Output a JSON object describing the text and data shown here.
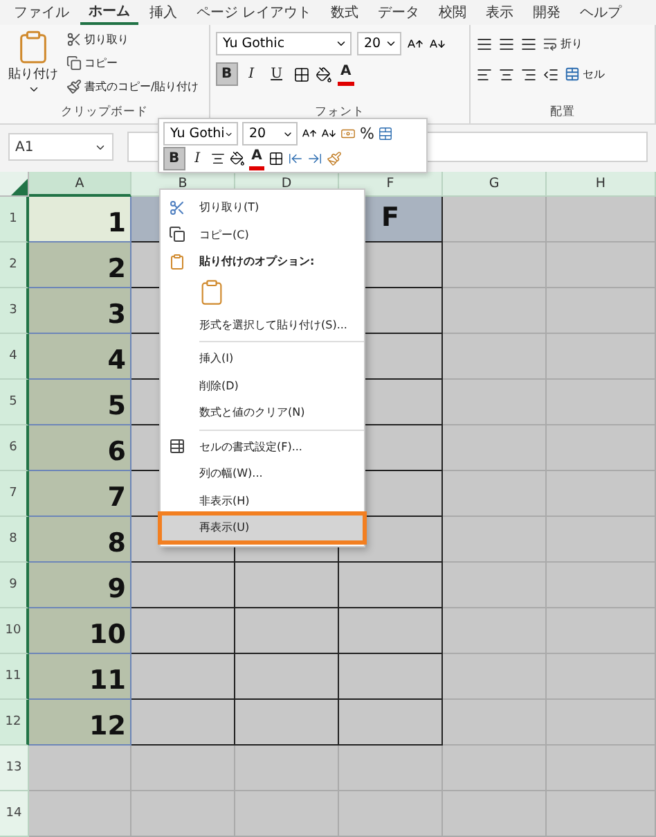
{
  "ribbon": {
    "tabs": [
      {
        "label": "ファイル",
        "selected": false
      },
      {
        "label": "ホーム",
        "selected": true
      },
      {
        "label": "挿入",
        "selected": false
      },
      {
        "label": "ページ レイアウト",
        "selected": false
      },
      {
        "label": "数式",
        "selected": false
      },
      {
        "label": "データ",
        "selected": false
      },
      {
        "label": "校閲",
        "selected": false
      },
      {
        "label": "表示",
        "selected": false
      },
      {
        "label": "開発",
        "selected": false
      },
      {
        "label": "ヘルプ",
        "selected": false
      }
    ]
  },
  "clipboard": {
    "paste": "貼り付け",
    "commands": [
      {
        "kind": "cut",
        "label": "切り取り"
      },
      {
        "kind": "copy",
        "label": "コピー"
      },
      {
        "kind": "format-painter",
        "label": "書式のコピー/貼り付け"
      }
    ],
    "group_label": "クリップボード"
  },
  "font": {
    "name": "Yu Gothic",
    "size": "20",
    "bold": {
      "label": "B",
      "selected": true
    },
    "italic": "I",
    "underline": "U",
    "color_letter": "A",
    "group_label": "フォント"
  },
  "alignment": {
    "wrap": "折り",
    "merge": "セル",
    "group_label": "配置"
  },
  "name_box": "A1",
  "mini_toolbar": {
    "font": "Yu Gothi",
    "size": "20",
    "percent": "%",
    "bold": {
      "label": "B",
      "selected": true
    },
    "italic": "I",
    "color_letter": "A"
  },
  "columns": [
    {
      "label": "A",
      "selected": true
    },
    {
      "label": "B",
      "selected": false
    },
    {
      "label": "D",
      "selected": false
    },
    {
      "label": "F",
      "selected": false
    },
    {
      "label": "G",
      "selected": false
    },
    {
      "label": "H",
      "selected": false
    }
  ],
  "rows": [
    {
      "label": "1",
      "selected": true,
      "active": true,
      "highlighted": true,
      "bordered": true,
      "cells": {
        "A": "1",
        "F": "F"
      }
    },
    {
      "label": "2",
      "selected": true,
      "active": false,
      "highlighted": false,
      "bordered": true,
      "cells": {
        "A": "2"
      }
    },
    {
      "label": "3",
      "selected": true,
      "active": false,
      "highlighted": false,
      "bordered": true,
      "cells": {
        "A": "3"
      }
    },
    {
      "label": "4",
      "selected": true,
      "active": false,
      "highlighted": false,
      "bordered": true,
      "cells": {
        "A": "4"
      }
    },
    {
      "label": "5",
      "selected": true,
      "active": false,
      "highlighted": false,
      "bordered": true,
      "cells": {
        "A": "5"
      }
    },
    {
      "label": "6",
      "selected": true,
      "active": false,
      "highlighted": false,
      "bordered": true,
      "cells": {
        "A": "6"
      }
    },
    {
      "label": "7",
      "selected": true,
      "active": false,
      "highlighted": false,
      "bordered": true,
      "cells": {
        "A": "7"
      }
    },
    {
      "label": "8",
      "selected": true,
      "active": false,
      "highlighted": false,
      "bordered": true,
      "cells": {
        "A": "8"
      }
    },
    {
      "label": "9",
      "selected": true,
      "active": false,
      "highlighted": false,
      "bordered": true,
      "cells": {
        "A": "9"
      }
    },
    {
      "label": "10",
      "selected": true,
      "active": false,
      "highlighted": false,
      "bordered": true,
      "cells": {
        "A": "10"
      }
    },
    {
      "label": "11",
      "selected": true,
      "active": false,
      "highlighted": false,
      "bordered": true,
      "cells": {
        "A": "11"
      }
    },
    {
      "label": "12",
      "selected": true,
      "active": false,
      "highlighted": false,
      "bordered": true,
      "cells": {
        "A": "12"
      }
    },
    {
      "label": "13",
      "selected": false,
      "highlighted": false,
      "bordered": false
    },
    {
      "label": "14",
      "selected": false,
      "highlighted": false,
      "bordered": false
    }
  ],
  "context_menu": [
    {
      "kind": "cut",
      "label": "切り取り(T)",
      "selected": false
    },
    {
      "kind": "copy",
      "label": "コピー(C)",
      "selected": false
    },
    {
      "kind": "paste-heading",
      "label": "貼り付けのオプション:",
      "selected": false
    },
    {
      "kind": "paste-button",
      "selected": false
    },
    {
      "kind": "command",
      "label": "形式を選択して貼り付け(S)...",
      "selected": false
    },
    {
      "kind": "separator"
    },
    {
      "kind": "command",
      "label": "挿入(I)",
      "selected": false
    },
    {
      "kind": "command",
      "label": "削除(D)",
      "selected": false
    },
    {
      "kind": "command",
      "label": "数式と値のクリア(N)",
      "selected": false
    },
    {
      "kind": "separator"
    },
    {
      "kind": "format-cells",
      "label": "セルの書式設定(F)...",
      "selected": false
    },
    {
      "kind": "command",
      "label": "列の幅(W)...",
      "selected": false
    },
    {
      "kind": "command",
      "label": "非表示(H)",
      "selected": false
    },
    {
      "kind": "command",
      "label": "再表示(U)",
      "selected": true
    }
  ]
}
